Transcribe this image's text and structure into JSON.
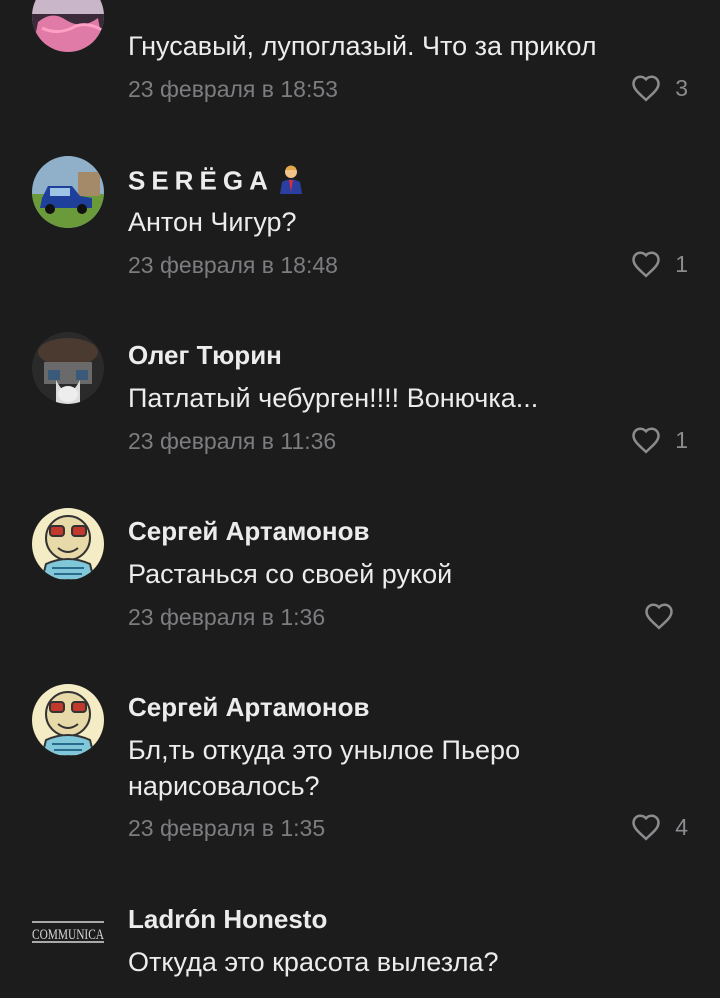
{
  "comments": [
    {
      "author": "",
      "text": "Гнусавый, лупоглазый. Что за прикол",
      "date": "23 февраля в 18:53",
      "likes": "3",
      "avatar": "pink-landscape-avatar"
    },
    {
      "author": "SERЁGA",
      "author_emoji": "businessman-emoji",
      "text": "Антон Чигур?",
      "date": "23 февраля в 18:48",
      "likes": "1",
      "avatar": "blue-car-avatar"
    },
    {
      "author": "Олег Тюрин",
      "text": "Патлатый чебурген!!!! Вонючка...",
      "date": "23 февраля в 11:36",
      "likes": "1",
      "avatar": "masked-face-avatar"
    },
    {
      "author": "Сергей Артамонов",
      "text": "Растанься со своей рукой",
      "date": "23 февраля в 1:36",
      "likes": "",
      "avatar": "cartoon-character-avatar"
    },
    {
      "author": "Сергей Артамонов",
      "text": "Бл,ть откуда это унылое Пьеро нарисовалось?",
      "date": "23 февраля в 1:35",
      "likes": "4",
      "avatar": "cartoon-character-avatar"
    },
    {
      "author": "Ladrón Honesto",
      "text": "Откуда это красота вылезла?",
      "date": "",
      "likes": "",
      "avatar": "communica-logo-avatar",
      "avatar_text": "COMMUNICA"
    }
  ],
  "colors": {
    "background": "#1c1c1d",
    "text": "#ececec",
    "muted": "#7d7d80",
    "icon": "#8c8c8f"
  },
  "icons": {
    "like": "heart-outline-icon"
  }
}
